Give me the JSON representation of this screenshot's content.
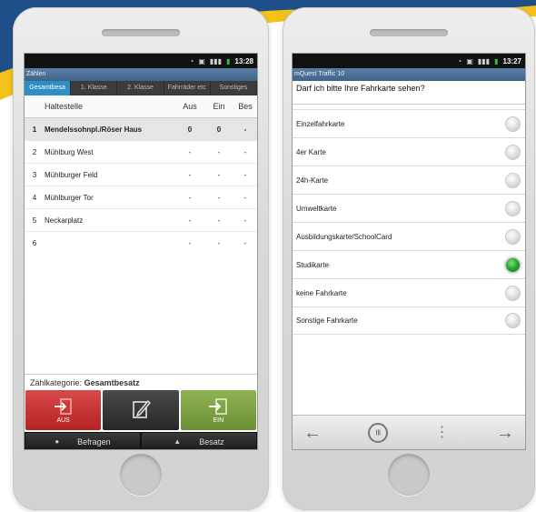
{
  "left": {
    "status_time": "13:28",
    "app_title": "Zählen",
    "tabs": [
      "Gesamtbesa",
      "1. Klasse",
      "2. Klasse",
      "Fahrräder etc",
      "Sonstiges"
    ],
    "table": {
      "headers": [
        "Haltestelle",
        "Aus",
        "Ein",
        "Bes"
      ],
      "rows": [
        {
          "num": "1",
          "name": "Mendelssohnpl./Röser Haus",
          "aus": "0",
          "ein": "0",
          "bes": "-"
        },
        {
          "num": "2",
          "name": "Mühlburg West",
          "aus": "-",
          "ein": "-",
          "bes": "-"
        },
        {
          "num": "3",
          "name": "Mühlburger Feld",
          "aus": "-",
          "ein": "-",
          "bes": "-"
        },
        {
          "num": "4",
          "name": "Mühlburger Tor",
          "aus": "-",
          "ein": "-",
          "bes": "-"
        },
        {
          "num": "5",
          "name": "Neckarplatz",
          "aus": "-",
          "ein": "-",
          "bes": "-"
        },
        {
          "num": "6",
          "name": "",
          "aus": "-",
          "ein": "-",
          "bes": "-"
        }
      ]
    },
    "category_label": "Zählkategorie:",
    "category_value": "Gesamtbesatz",
    "actions": {
      "aus": "AUS",
      "ein": "EIN"
    },
    "bottom": {
      "befragen": "Befragen",
      "besatz": "Besatz"
    }
  },
  "right": {
    "status_time": "13:27",
    "app_title": "mQuest Traffic 10",
    "question": "Darf ich bitte Ihre Fahrkarte sehen?",
    "options": [
      {
        "label": "Einzelfahrkarte",
        "checked": false
      },
      {
        "label": "4er Karte",
        "checked": false
      },
      {
        "label": "24h-Karte",
        "checked": false
      },
      {
        "label": "Umweltkarte",
        "checked": false
      },
      {
        "label": "Ausbildungskarte/SchoolCard",
        "checked": false
      },
      {
        "label": "Studikarte",
        "checked": true
      },
      {
        "label": "keine Fahrkarte",
        "checked": false
      },
      {
        "label": "Sonstige Fahrkarte",
        "checked": false
      }
    ],
    "nav": {
      "center_icon_text": "|||"
    }
  },
  "colors": {
    "accent_tab": "#2f8fc5",
    "aus_red": "#c63333",
    "ein_green": "#7da043",
    "selected_radio": "#22a52a"
  }
}
